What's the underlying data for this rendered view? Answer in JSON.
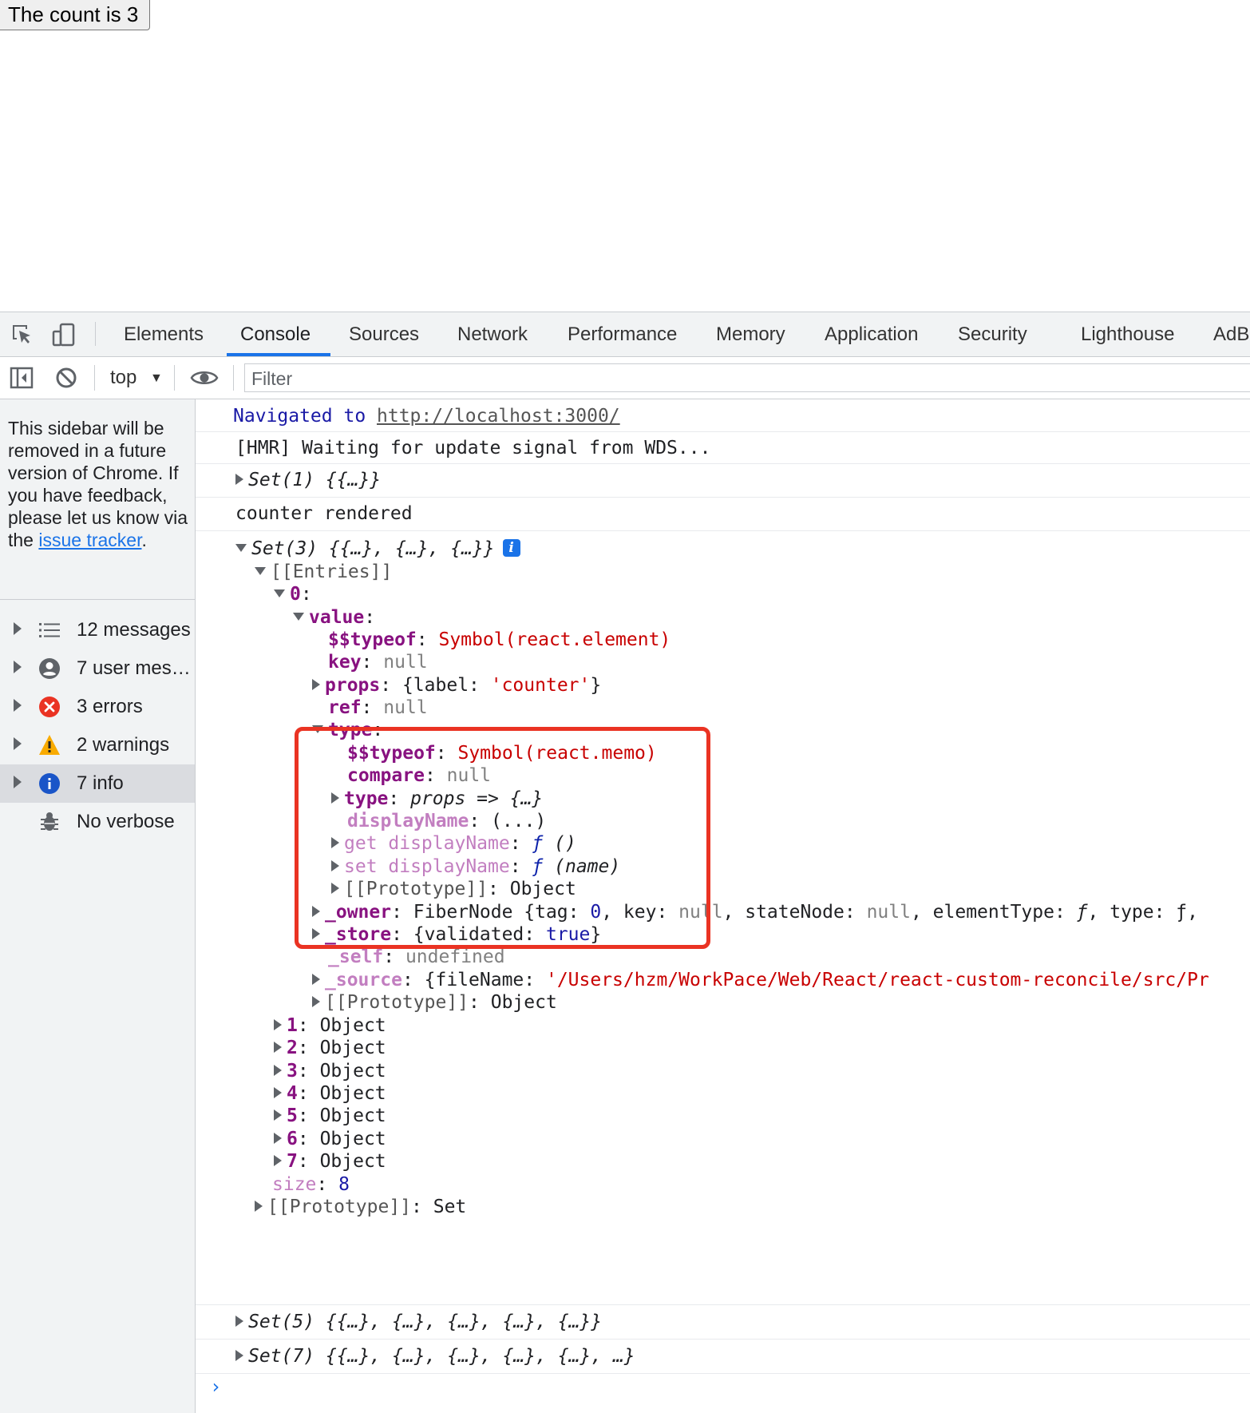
{
  "page": {
    "button_label": "The count is 3"
  },
  "devtools": {
    "tabs": [
      {
        "label": "Elements"
      },
      {
        "label": "Console"
      },
      {
        "label": "Sources"
      },
      {
        "label": "Network"
      },
      {
        "label": "Performance"
      },
      {
        "label": "Memory"
      },
      {
        "label": "Application"
      },
      {
        "label": "Security"
      },
      {
        "label": "Lighthouse"
      },
      {
        "label": "AdB"
      }
    ],
    "active_tab": "Console",
    "toolbar": {
      "context": "top",
      "filter_placeholder": "Filter"
    }
  },
  "sidebar": {
    "note_text": "This sidebar will be removed in a future version of Chrome. If you have feedback, please let us know via the ",
    "note_link": "issue tracker",
    "note_end": ".",
    "items": [
      {
        "label": "12 messages",
        "icon": "list-icon"
      },
      {
        "label": "7 user mes…",
        "icon": "user-icon"
      },
      {
        "label": "3 errors",
        "icon": "error-icon"
      },
      {
        "label": "2 warnings",
        "icon": "warning-icon"
      },
      {
        "label": "7 info",
        "icon": "info-icon"
      },
      {
        "label": "No verbose",
        "icon": "bug-icon"
      }
    ]
  },
  "console": {
    "nav_prefix": "Navigated to ",
    "nav_url": "http://localhost:3000/",
    "hmr": "[HMR] Waiting for update signal from WDS...",
    "set1": "Set(1) {{…}}",
    "counter": "counter rendered",
    "set3": "Set(3) {{…}, {…}, {…}}",
    "entries": "[[Entries]]",
    "entry0": "0",
    "value_key": "value",
    "typeof_key": "$$typeof",
    "typeof_val": "Symbol(react.element)",
    "key_key": "key",
    "null": "null",
    "props_key": "props",
    "props_open": "{label: ",
    "props_str": "'counter'",
    "props_close": "}",
    "ref_key": "ref",
    "type_key": "type",
    "memo_val": "Symbol(react.memo)",
    "compare_key": "compare",
    "type_val": "props => {…}",
    "display_key": "displayName",
    "display_val": "(...)",
    "get_display": "get displayName",
    "set_display": "set displayName",
    "fn_sym": "ƒ",
    "get_args": "()",
    "set_args": "(name)",
    "proto_key": "[[Prototype]]",
    "object": "Object",
    "owner_key": "_owner",
    "owner_val_pre": "FiberNode {tag: ",
    "owner_tag": "0",
    "owner_val_mid": ", key: ",
    "owner_val_mid2": ", stateNode: ",
    "owner_val_mid3": ", elementType: ",
    "owner_val_end": ", type: ƒ,",
    "store_key": "_store",
    "store_pre": "{validated: ",
    "store_true": "true",
    "store_end": "}",
    "self_key": "_self",
    "undefined": "undefined",
    "source_key": "_source",
    "source_pre": "{fileName: ",
    "source_str": "'/Users/hzm/WorkPace/Web/React/react-custom-reconcile/src/Pr",
    "entries_rest": [
      "1",
      "2",
      "3",
      "4",
      "5",
      "6",
      "7"
    ],
    "size_key": "size",
    "size_val": "8",
    "set_proto": "Set",
    "set5": "Set(5) {{…}, {…}, {…}, {…}, {…}}",
    "set7": "Set(7) {{…}, {…}, {…}, {…}, {…}, …}",
    "prompt": "›"
  }
}
